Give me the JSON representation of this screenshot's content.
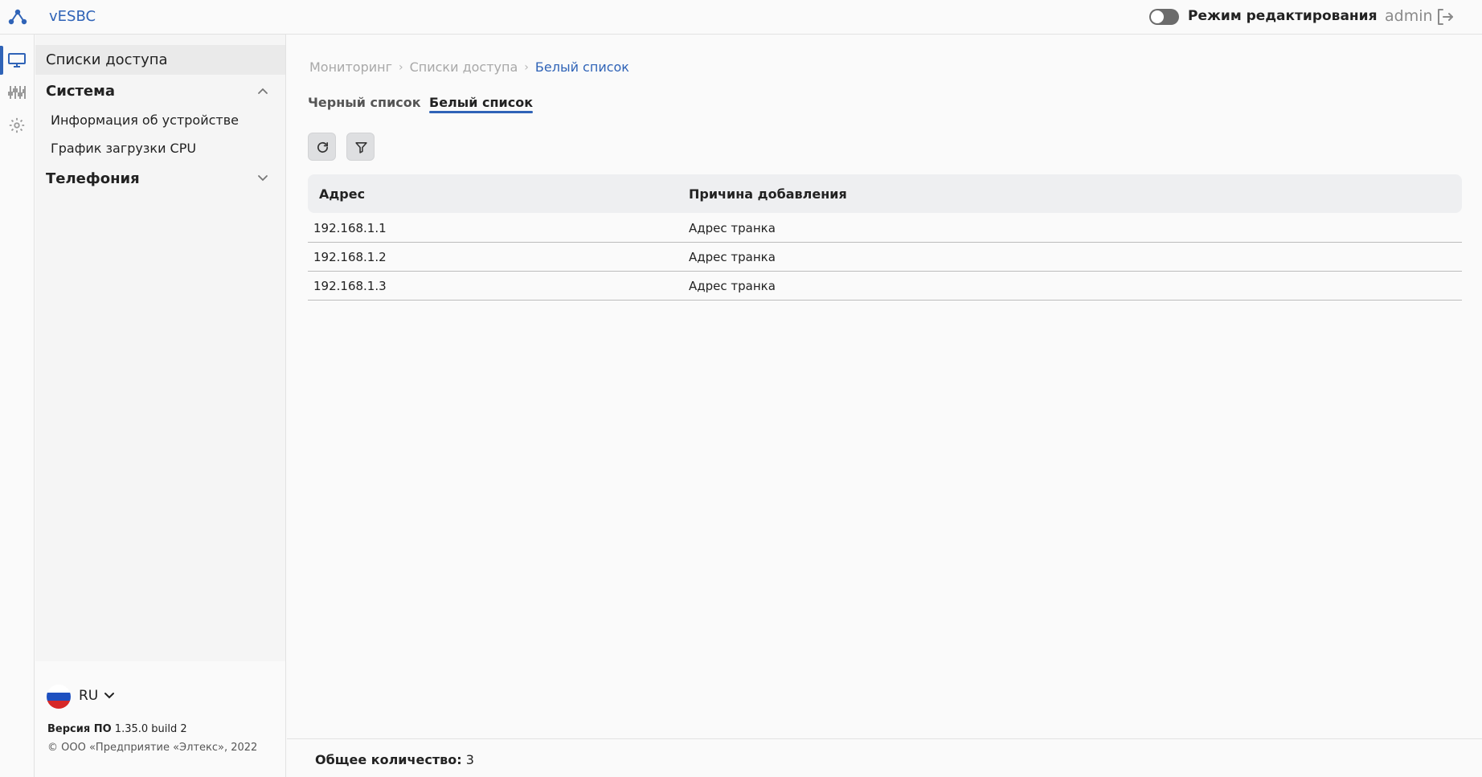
{
  "app": {
    "title": "vESBC",
    "edit_mode_label": "Режим редактирования",
    "edit_mode_on": false,
    "user": "admin",
    "accent": "#2f63b7"
  },
  "rail": {
    "items": [
      {
        "icon": "monitor-icon",
        "active": true
      },
      {
        "icon": "sliders-icon",
        "active": false
      },
      {
        "icon": "gear-icon",
        "active": false
      }
    ],
    "collapse_icon": "chevron-left-icon"
  },
  "sidebar": {
    "active_item": "Списки доступа",
    "groups": [
      {
        "label": "Система",
        "expanded": true,
        "items": [
          "Информация об устройстве",
          "График загрузки CPU"
        ]
      },
      {
        "label": "Телефония",
        "expanded": false,
        "items": []
      }
    ],
    "language": "RU",
    "version_label": "Версия ПО",
    "version_value": "1.35.0 build 2",
    "copyright": "© ООО «Предприятие «Элтекс», 2022"
  },
  "breadcrumb": [
    "Мониторинг",
    "Списки доступа",
    "Белый список"
  ],
  "tabs": [
    {
      "label": "Черный список",
      "active": false
    },
    {
      "label": "Белый список",
      "active": true
    }
  ],
  "toolbar": {
    "refresh_icon": "refresh-icon",
    "filter_icon": "filter-icon"
  },
  "table": {
    "columns": [
      "Адрес",
      "Причина добавления"
    ],
    "rows": [
      [
        "192.168.1.1",
        "Адрес транка"
      ],
      [
        "192.168.1.2",
        "Адрес транка"
      ],
      [
        "192.168.1.3",
        "Адрес транка"
      ]
    ]
  },
  "footer": {
    "total_label": "Общее количество:",
    "total_value": "3"
  }
}
